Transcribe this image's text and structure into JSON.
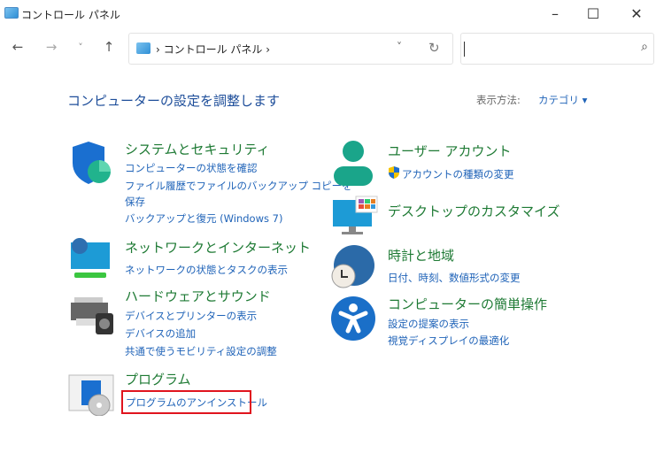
{
  "window": {
    "title": "コントロール パネル",
    "minimize": "–",
    "maximize": "☐",
    "close": "✕"
  },
  "nav": {
    "back": "←",
    "forward": "→",
    "recent": "˅",
    "up": "↑"
  },
  "address": {
    "path": "› コントロール パネル ›",
    "dropdown": "˅",
    "refresh": "↻"
  },
  "search": {
    "value": "",
    "icon": "⌕"
  },
  "main": {
    "heading": "コンピューターの設定を調整します",
    "view_label": "表示方法:",
    "view_value": "カテゴリ ▾"
  },
  "categories_left": [
    {
      "title": "システムとセキュリティ",
      "links": [
        "コンピューターの状態を確認",
        "ファイル履歴でファイルのバックアップ コピーを",
        "保存",
        "バックアップと復元 (Windows 7)"
      ]
    },
    {
      "title": "ネットワークとインターネット",
      "links": [
        "ネットワークの状態とタスクの表示"
      ]
    },
    {
      "title": "ハードウェアとサウンド",
      "links": [
        "デバイスとプリンターの表示",
        "デバイスの追加",
        "共通で使うモビリティ設定の調整"
      ]
    },
    {
      "title": "プログラム",
      "links": [
        "プログラムのアンインストール"
      ]
    }
  ],
  "categories_right": [
    {
      "title": "ユーザー アカウント",
      "links": [
        "アカウントの種類の変更"
      ]
    },
    {
      "title": "デスクトップのカスタマイズ",
      "links": []
    },
    {
      "title": "時計と地域",
      "links": [
        "日付、時刻、数値形式の変更"
      ]
    },
    {
      "title": "コンピューターの簡単操作",
      "links": [
        "設定の提案の表示",
        "視覚ディスプレイの最適化"
      ]
    }
  ],
  "colors": {
    "title_green": "#1e7a34",
    "link_blue": "#1f63b8",
    "heading_blue": "#1e4e9a",
    "highlight_red": "#e0141e"
  }
}
